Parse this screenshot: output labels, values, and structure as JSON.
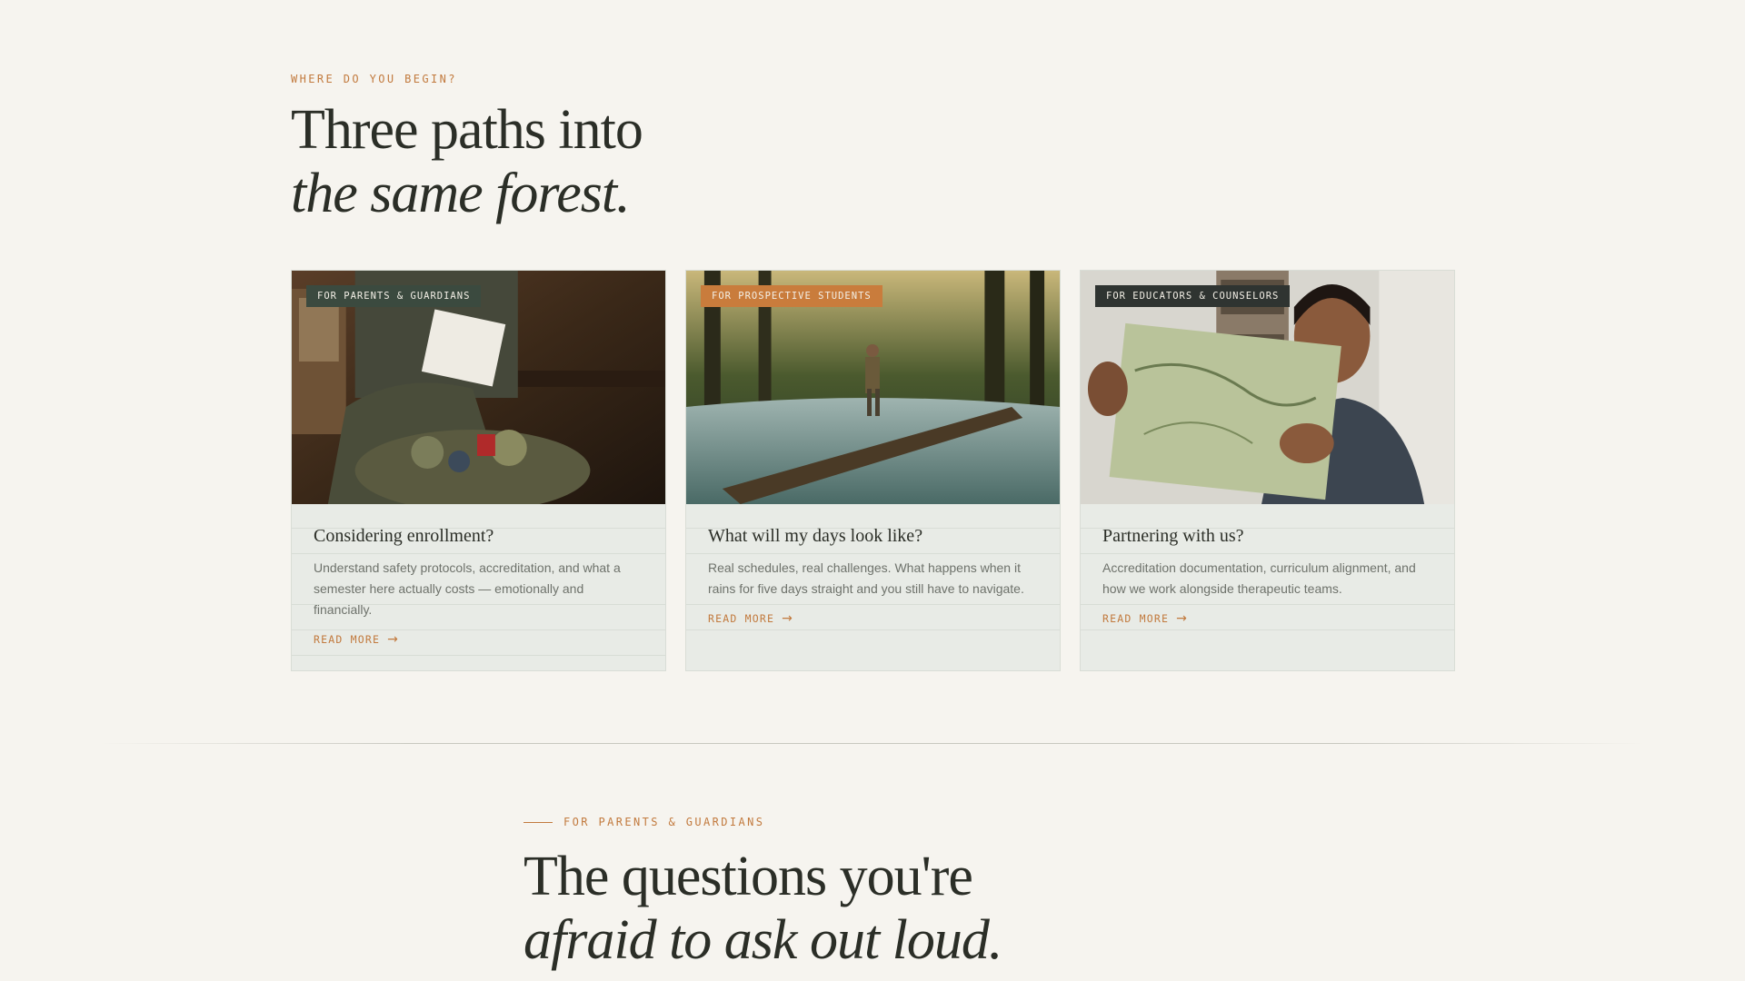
{
  "intro": {
    "eyebrow": "WHERE DO YOU BEGIN?",
    "headline_line1": "Three paths into",
    "headline_line2": "the same forest."
  },
  "cards": [
    {
      "tag": "FOR PARENTS & GUARDIANS",
      "title": "Considering enrollment?",
      "description": "Understand safety protocols, accreditation, and what a semester here actually costs — emotionally and financially.",
      "link": "READ MORE",
      "image_icon": "parent-notepad-photo"
    },
    {
      "tag": "FOR PROSPECTIVE STUDENTS",
      "title": "What will my days look like?",
      "description": "Real schedules, real challenges. What happens when it rains for five days straight and you still have to navigate.",
      "link": "READ MORE",
      "image_icon": "hiker-river-photo"
    },
    {
      "tag": "FOR EDUCATORS & COUNSELORS",
      "title": "Partnering with us?",
      "description": "Accreditation documentation, curriculum alignment, and how we work alongside therapeutic teams.",
      "link": "READ MORE",
      "image_icon": "educator-map-photo"
    }
  ],
  "section2": {
    "eyebrow": "FOR PARENTS & GUARDIANS",
    "headline_line1": "The questions you're",
    "headline_line2": "afraid to ask out loud."
  },
  "colors": {
    "background": "#f6f4ef",
    "accent": "#c27a3e",
    "text": "#2b2e27",
    "card": "#e8ebe6"
  }
}
